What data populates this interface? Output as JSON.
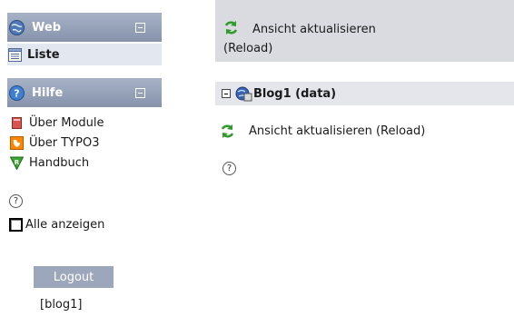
{
  "left_menu": {
    "web": {
      "title": "Web",
      "items": [
        {
          "label": "Liste",
          "icon": "list-icon"
        }
      ]
    },
    "hilfe": {
      "title": "Hilfe",
      "items": [
        {
          "label": "Über Module",
          "icon": "module-info-icon"
        },
        {
          "label": "Über TYPO3",
          "icon": "typo3-logo-icon"
        },
        {
          "label": "Handbuch",
          "icon": "manual-icon"
        }
      ]
    },
    "show_all_label": "Alle anzeigen",
    "logout_label": "Logout",
    "user": "[blog1]"
  },
  "content": {
    "reload_label": "Ansicht aktualisieren (Reload)",
    "reload_label_line1": "Ansicht aktualisieren",
    "reload_label_line2": "(Reload)",
    "tree_root": "Blog1 (data)"
  },
  "colors": {
    "group_header": "#8f9ab1",
    "logout_button": "#9da7bb",
    "top_bar": "#d9dbe0",
    "doc_header": "#e4e6ec",
    "active_item": "#e3e7ef"
  }
}
